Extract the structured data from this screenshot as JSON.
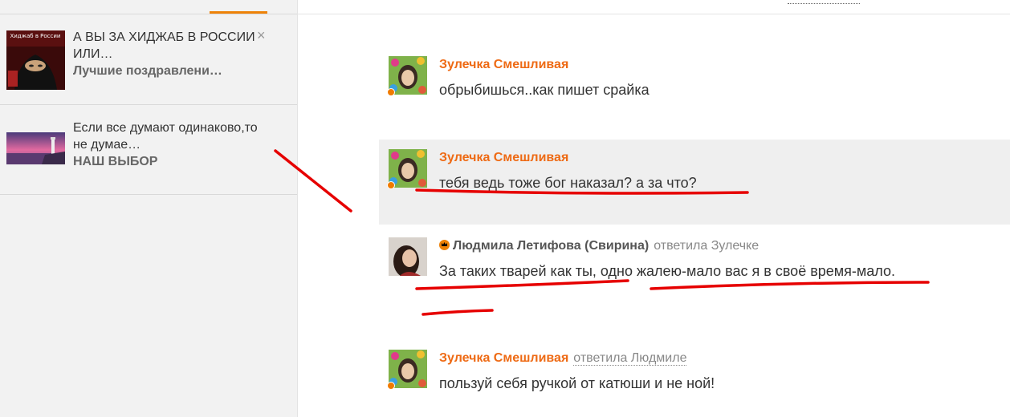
{
  "sidebar": {
    "notifications": [
      {
        "title": "А ВЫ ЗА ХИДЖАБ В РОССИИ ИЛИ…",
        "source": "Лучшие поздравлени…",
        "thumb_caption": "Хиджаб в России",
        "has_close": true,
        "close_label": "×"
      },
      {
        "title": "Если все думают одинаково,то не думае…",
        "source": "НАШ ВЫБОР",
        "has_close": false
      }
    ]
  },
  "comments": [
    {
      "author": "Зулечка Смешливая",
      "text": "обрыбишься..как пишет срайка",
      "online": true
    },
    {
      "author": "Зулечка Смешливая",
      "text": "тебя ведь тоже бог наказал? а за что?",
      "online": true,
      "highlighted": true
    },
    {
      "author": "Людмила Летифова (Свирина)",
      "replied_to": "ответила Зулечке",
      "text": "За таких тварей как ты, одно жалею-мало вас я в своё время-мало.",
      "crown": true
    },
    {
      "author": "Зулечка Смешливая",
      "replied_to": "ответила Людмиле",
      "text": "пользуй себя ручкой от катюши и не ной!",
      "online": true
    }
  ],
  "colors": {
    "accent": "#ee8208",
    "author": "#ee6a14",
    "annotation": "#e60000",
    "highlight_bg": "#efefef"
  }
}
